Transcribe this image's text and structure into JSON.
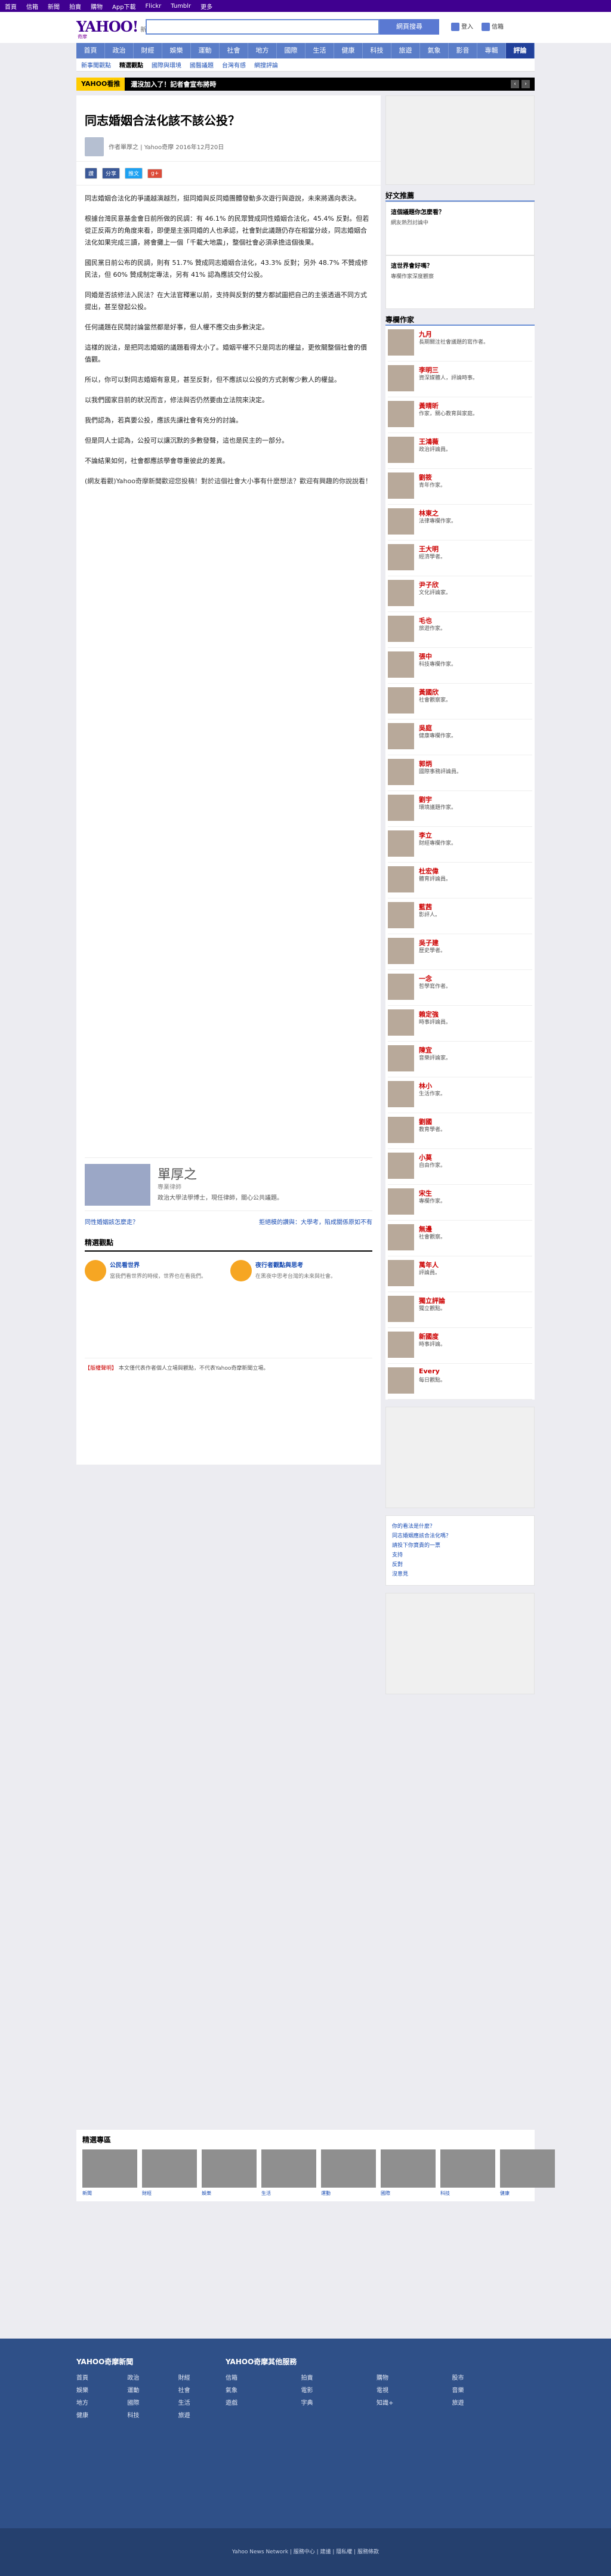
{
  "topbar": [
    "首頁",
    "信箱",
    "新聞",
    "拍賣",
    "購物",
    "App下載",
    "Flickr",
    "Tumblr",
    "更多"
  ],
  "header": {
    "logo": "YAHOO!",
    "logo_sub": "奇摩",
    "section": "新聞",
    "search_button": "網頁搜尋",
    "login": "登入",
    "mail": "信箱"
  },
  "nav": [
    "首頁",
    "政治",
    "財經",
    "娛樂",
    "運動",
    "社會",
    "地方",
    "國際",
    "生活",
    "健康",
    "科技",
    "旅遊",
    "氣象",
    "影音",
    "專輯",
    "評論"
  ],
  "subnav": [
    "新事聞觀點",
    "精選觀點",
    "國際與環境",
    "國醫議題",
    "台灣有感",
    "網搜評論"
  ],
  "hot": {
    "label": "YAHOO看推",
    "text": "還沒加入了！記者會宣布將時",
    "prev": "‹",
    "next": "›"
  },
  "article": {
    "title": "同志婚姻合法化該不該公投？",
    "author_line": "作者單厚之 | Yahoo奇摩 2016年12月20日",
    "share": [
      "讚",
      "分享",
      "推文",
      "g+"
    ],
    "paragraphs": [
      "同志婚姻合法化的爭議越演越烈，挺同婚與反同婚團體發動多次遊行與遊說，未來將邁向表決。",
      "根據台灣民意基金會日前所做的民調：有 46.1% 的民眾贊成同性婚姻合法化，45.4% 反對。但若從正反兩方的角度來看，即便是主張同婚的人也承認，社會對此議題仍存在相當分歧，同志婚姻合法化如果完成三讀，將會攤上一個「千載大地震」，整個社會必須承擔這個後果。",
      "國民黨日前公布的民調，則有 51.7% 贊成同志婚姻合法化，43.3% 反對；另外 48.7% 不贊成修民法，但 60% 贊成制定專法，另有 41% 認為應該交付公投。",
      "同婚是否該修法入民法？在大法官釋憲以前，支持與反對的雙方都試圖把自己的主張透過不同方式提出，甚至發起公投。",
      "任何議題在民間討論當然都是好事，但人權不應交由多數決定。",
      "這樣的說法，是把同志婚姻的議題看得太小了。婚姻平權不只是同志的權益，更攸關整個社會的價值觀。",
      "所以，你可以對同志婚姻有意見，甚至反對，但不應該以公投的方式剝奪少數人的權益。",
      "以我們國家目前的狀況而言，修法與否仍然要由立法院來決定。",
      "我們認為，若真要公投，應該先讓社會有充分的討論。",
      "但是同人士認為，公投可以讓沉默的多數發聲，這也是民主的一部分。",
      "不論結果如何，社會都應該學會尊重彼此的差異。"
    ],
    "footer_note": "(網友看觀)Yahoo奇摩新聞歡迎您投稿！對於這個社會大小事有什麼想法？歡迎有興趣的你說說看！",
    "author": {
      "name": "單厚之",
      "role": "專業律師",
      "bio": "政治大學法學博士，現任律師，關心公共議題。"
    },
    "prev": "同性婚姻該怎麼走？",
    "next": "拒絕模的讚與：大學考，陷成關係原如不有"
  },
  "columnists_header": "精選觀點",
  "columnists_items": [
    {
      "title": "公民看世界",
      "desc": "當我們看世界的時候，世界也在看我們。"
    },
    {
      "title": "夜行者觀點與思考",
      "desc": "在黑夜中思考台灣的未來與社會。"
    }
  ],
  "notice": {
    "tag": "【版權聲明】",
    "text": "本文僅代表作者個人立場與觀點，不代表Yahoo奇摩新聞立場。"
  },
  "sidebar": {
    "hot_header": "好文推薦",
    "hot": [
      {
        "title": "這個議題你怎麼看？",
        "desc": "網友熱烈討論中"
      },
      {
        "title": "這世界會好嗎？",
        "desc": "專欄作家深度觀察"
      }
    ],
    "authors_header": "專欄作家",
    "authors": [
      {
        "name": "九月",
        "desc": "長期關注社會議題的寫作者。"
      },
      {
        "name": "李明三",
        "desc": "資深媒體人，評論時事。"
      },
      {
        "name": "黃晴昕",
        "desc": "作家，關心教育與家庭。"
      },
      {
        "name": "王鴻薇",
        "desc": "政治評論員。"
      },
      {
        "name": "劉筱",
        "desc": "青年作家。"
      },
      {
        "name": "林東之",
        "desc": "法律專欄作家。"
      },
      {
        "name": "王大明",
        "desc": "經濟學者。"
      },
      {
        "name": "尹子欣",
        "desc": "文化評論家。"
      },
      {
        "name": "毛也",
        "desc": "旅遊作家。"
      },
      {
        "name": "張中",
        "desc": "科技專欄作家。"
      },
      {
        "name": "黃國欣",
        "desc": "社會觀察家。"
      },
      {
        "name": "吳庭",
        "desc": "健康專欄作家。"
      },
      {
        "name": "郭炳",
        "desc": "國際事務評論員。"
      },
      {
        "name": "劉宇",
        "desc": "環境議題作家。"
      },
      {
        "name": "李立",
        "desc": "財經專欄作家。"
      },
      {
        "name": "杜宏偉",
        "desc": "體育評論員。"
      },
      {
        "name": "藍茜",
        "desc": "影評人。"
      },
      {
        "name": "吳子建",
        "desc": "歷史學者。"
      },
      {
        "name": "一念",
        "desc": "哲學寫作者。"
      },
      {
        "name": "賴定強",
        "desc": "時事評論員。"
      },
      {
        "name": "陳宜",
        "desc": "音樂評論家。"
      },
      {
        "name": "林小",
        "desc": "生活作家。"
      },
      {
        "name": "劉國",
        "desc": "教育學者。"
      },
      {
        "name": "小莫",
        "desc": "自由作家。"
      },
      {
        "name": "宋生",
        "desc": "專欄作家。"
      },
      {
        "name": "無邊",
        "desc": "社會觀察。"
      },
      {
        "name": "萬年人",
        "desc": "評論員。"
      },
      {
        "name": "獨立評論",
        "desc": "獨立觀點。"
      },
      {
        "name": "新國度",
        "desc": "時事評論。"
      },
      {
        "name": "Every",
        "desc": "每日觀點。"
      }
    ],
    "poll": [
      "你的看法是什麼？",
      "同志婚姻應該合法化嗎？",
      "請投下你寶貴的一票",
      "支持",
      "反對",
      "沒意見"
    ]
  },
  "recent": {
    "header": "精選專區",
    "items": [
      "新聞",
      "財經",
      "娛樂",
      "生活",
      "運動",
      "國際",
      "科技",
      "健康"
    ]
  },
  "footer": {
    "col1_header": "YAHOO奇摩新聞",
    "col1": [
      "首頁",
      "政治",
      "財經",
      "娛樂",
      "運動",
      "社會",
      "地方",
      "國際",
      "生活",
      "健康",
      "科技",
      "旅遊"
    ],
    "col2_header": "YAHOO奇摩其他服務",
    "col2": [
      "信箱",
      "拍賣",
      "購物",
      "股市",
      "氣象",
      "電影",
      "電視",
      "音樂",
      "遊戲",
      "字典",
      "知識+",
      "旅遊"
    ],
    "bottom": "Yahoo News Network | 服務中心 | 建議 | 隱私權 | 服務條款"
  }
}
